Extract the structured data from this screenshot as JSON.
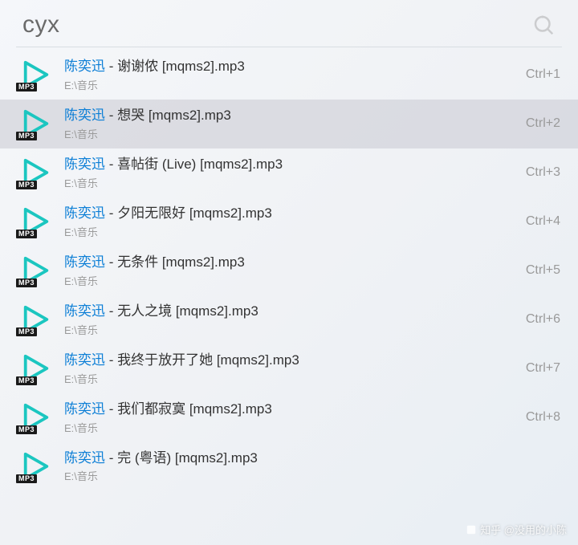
{
  "header": {
    "search_query": "cyx"
  },
  "badge_label": "MP3",
  "title_separator": " - ",
  "results": [
    {
      "artist": "陈奕迅",
      "rest": "谢谢侬 [mqms2].mp3",
      "path": "E:\\音乐",
      "shortcut": "Ctrl+1",
      "selected": false
    },
    {
      "artist": "陈奕迅",
      "rest": "想哭 [mqms2].mp3",
      "path": "E:\\音乐",
      "shortcut": "Ctrl+2",
      "selected": true
    },
    {
      "artist": "陈奕迅",
      "rest": "喜帖街 (Live) [mqms2].mp3",
      "path": "E:\\音乐",
      "shortcut": "Ctrl+3",
      "selected": false
    },
    {
      "artist": "陈奕迅",
      "rest": "夕阳无限好 [mqms2].mp3",
      "path": "E:\\音乐",
      "shortcut": "Ctrl+4",
      "selected": false
    },
    {
      "artist": "陈奕迅",
      "rest": "无条件 [mqms2].mp3",
      "path": "E:\\音乐",
      "shortcut": "Ctrl+5",
      "selected": false
    },
    {
      "artist": "陈奕迅",
      "rest": "无人之境 [mqms2].mp3",
      "path": "E:\\音乐",
      "shortcut": "Ctrl+6",
      "selected": false
    },
    {
      "artist": "陈奕迅",
      "rest": "我终于放开了她 [mqms2].mp3",
      "path": "E:\\音乐",
      "shortcut": "Ctrl+7",
      "selected": false
    },
    {
      "artist": "陈奕迅",
      "rest": "我们都寂寞 [mqms2].mp3",
      "path": "E:\\音乐",
      "shortcut": "Ctrl+8",
      "selected": false
    },
    {
      "artist": "陈奕迅",
      "rest": "完 (粤语) [mqms2].mp3",
      "path": "E:\\音乐",
      "shortcut": "",
      "selected": false
    }
  ],
  "watermark": "知乎 @没用的小陈"
}
